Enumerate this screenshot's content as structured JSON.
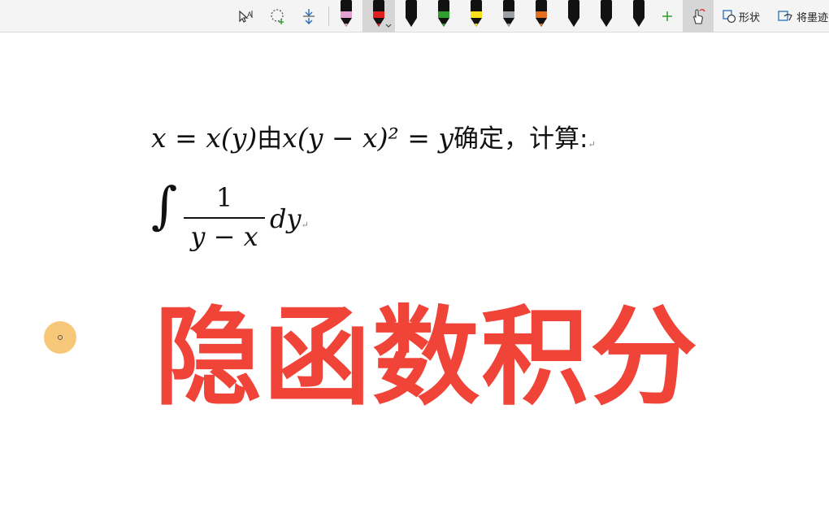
{
  "toolbar": {
    "tools": [
      {
        "name": "lasso-select-icon"
      },
      {
        "name": "add-space-icon"
      },
      {
        "name": "insert-space-icon"
      }
    ],
    "pens": [
      {
        "color": "#e0a0d0",
        "tip": "#222",
        "name": "pen-pink"
      },
      {
        "color": "#e02020",
        "tip": "#222",
        "name": "pen-red",
        "active": true
      },
      {
        "color": "#111111",
        "tip": "#111",
        "name": "pen-black-1"
      },
      {
        "color": "#2e9e2e",
        "tip": "#111",
        "name": "pen-green"
      },
      {
        "color": "#f5e11c",
        "tip": "#111",
        "name": "highlighter-yellow"
      },
      {
        "color": "#9aa0a6",
        "tip": "#111",
        "name": "pen-galaxy"
      },
      {
        "color": "#e07020",
        "tip": "#111",
        "name": "pen-rainbow"
      },
      {
        "color": "#111111",
        "tip": "#111",
        "name": "pen-black-2"
      },
      {
        "color": "#111111",
        "tip": "#111",
        "name": "pen-black-3"
      },
      {
        "color": "#111111",
        "tip": "#111",
        "name": "pen-black-4"
      }
    ],
    "shapes_label": "形状",
    "ink_to_label": "将墨迹",
    "accent": "#e02020"
  },
  "document": {
    "line1": {
      "lhs": "x = x(y)",
      "text1": "由",
      "equation": "x(y − x)² = y",
      "text2": "确定，计算:",
      "mark": "↵"
    },
    "integral": {
      "sign": "∫",
      "numerator": "1",
      "denominator": "y − x",
      "differential": "dy",
      "mark": "↵"
    },
    "title": "隐函数积分",
    "title_color": "#f04438"
  }
}
